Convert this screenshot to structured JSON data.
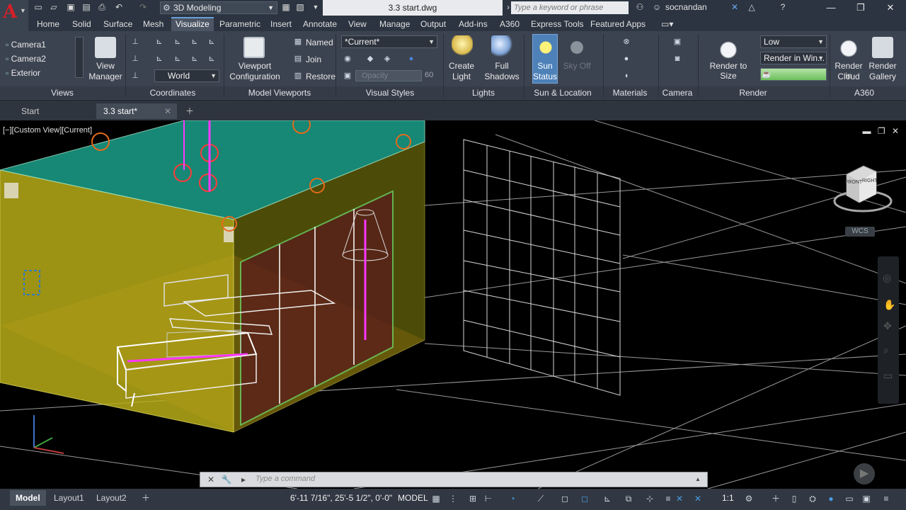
{
  "app": {
    "logo_letter": "A",
    "workspace": "3D Modeling",
    "document_title": "3.3 start.dwg",
    "search_placeholder": "Type a keyword or phrase",
    "user": "socnandan"
  },
  "ribbon_tabs": [
    "Home",
    "Solid",
    "Surface",
    "Mesh",
    "Visualize",
    "Parametric",
    "Insert",
    "Annotate",
    "View",
    "Manage",
    "Output",
    "Add-ins",
    "A360",
    "Express Tools",
    "Featured Apps"
  ],
  "active_ribbon_tab": "Visualize",
  "views_panel": {
    "title": "Views",
    "items": [
      "Camera1",
      "Camera2",
      "Exterior"
    ],
    "view_manager_line1": "View",
    "view_manager_line2": "Manager"
  },
  "coordinates_panel": {
    "title": "Coordinates",
    "ucs_value": "World"
  },
  "model_viewports_panel": {
    "title": "Model Viewports",
    "config_line1": "Viewport",
    "config_line2": "Configuration",
    "named": "Named",
    "join": "Join",
    "restore": "Restore"
  },
  "visual_styles_panel": {
    "title": "Visual Styles",
    "current": "*Current*",
    "opacity_label": "Opacity",
    "opacity_value": "60"
  },
  "lights_panel": {
    "title": "Lights",
    "create_light_1": "Create",
    "create_light_2": "Light",
    "full_shadows_1": "Full",
    "full_shadows_2": "Shadows"
  },
  "sun_panel": {
    "title": "Sun & Location",
    "sun_status_1": "Sun",
    "sun_status_2": "Status",
    "sky_off": "Sky Off"
  },
  "materials_panel": {
    "title": "Materials"
  },
  "camera_panel": {
    "title": "Camera"
  },
  "render_panel": {
    "title": "Render",
    "render_to_size": "Render to Size",
    "quality": "Low",
    "render_in": "Render in Win..."
  },
  "a360_panel": {
    "title": "A360",
    "cloud_1": "Render in",
    "cloud_2": "Cloud",
    "gallery_1": "Render",
    "gallery_2": "Gallery"
  },
  "file_tabs": [
    "Start",
    "3.3 start*"
  ],
  "viewport": {
    "label": "[−][Custom View][Current]",
    "wcs": "WCS",
    "cube_front": "FRONT",
    "cube_right": "RIGHT"
  },
  "command_line": {
    "placeholder": "Type a command"
  },
  "status_bar": {
    "layout_tabs": [
      "Model",
      "Layout1",
      "Layout2"
    ],
    "coordinates": "6'-11 7/16\", 25'-5 1/2\", 0'-0\"",
    "space": "MODEL",
    "annotation_scale": "1:1"
  }
}
